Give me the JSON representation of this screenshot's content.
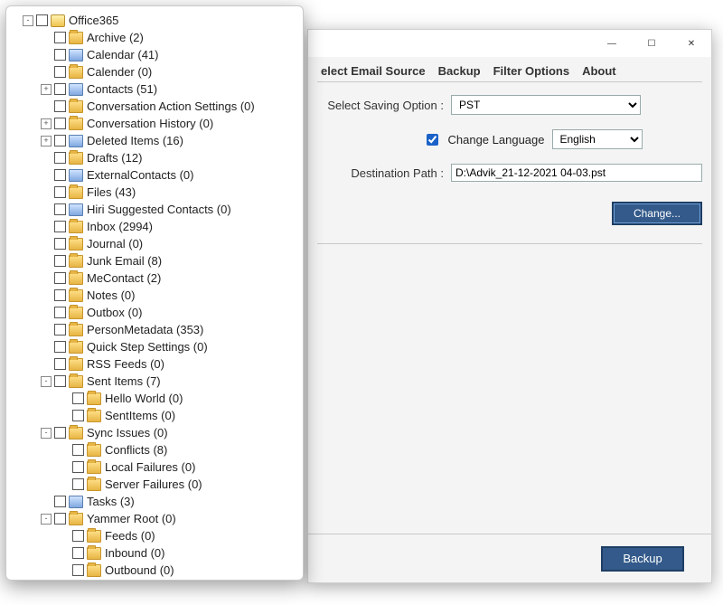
{
  "tree": {
    "root": "Office365",
    "items": [
      {
        "label": "Archive (2)",
        "exp": "",
        "d": 2,
        "icon": "folder"
      },
      {
        "label": "Calendar (41)",
        "exp": "",
        "d": 2,
        "icon": "special"
      },
      {
        "label": "Calender (0)",
        "exp": "",
        "d": 2,
        "icon": "folder"
      },
      {
        "label": "Contacts (51)",
        "exp": "+",
        "d": 2,
        "icon": "special"
      },
      {
        "label": "Conversation Action Settings (0)",
        "exp": "",
        "d": 2,
        "icon": "folder"
      },
      {
        "label": "Conversation History (0)",
        "exp": "+",
        "d": 2,
        "icon": "folder"
      },
      {
        "label": "Deleted Items (16)",
        "exp": "+",
        "d": 2,
        "icon": "special"
      },
      {
        "label": "Drafts (12)",
        "exp": "",
        "d": 2,
        "icon": "folder"
      },
      {
        "label": "ExternalContacts (0)",
        "exp": "",
        "d": 2,
        "icon": "special"
      },
      {
        "label": "Files (43)",
        "exp": "",
        "d": 2,
        "icon": "folder"
      },
      {
        "label": "Hiri Suggested Contacts (0)",
        "exp": "",
        "d": 2,
        "icon": "special"
      },
      {
        "label": "Inbox (2994)",
        "exp": "",
        "d": 2,
        "icon": "folder"
      },
      {
        "label": "Journal (0)",
        "exp": "",
        "d": 2,
        "icon": "folder"
      },
      {
        "label": "Junk Email (8)",
        "exp": "",
        "d": 2,
        "icon": "folder"
      },
      {
        "label": "MeContact (2)",
        "exp": "",
        "d": 2,
        "icon": "folder"
      },
      {
        "label": "Notes (0)",
        "exp": "",
        "d": 2,
        "icon": "folder"
      },
      {
        "label": "Outbox (0)",
        "exp": "",
        "d": 2,
        "icon": "folder"
      },
      {
        "label": "PersonMetadata (353)",
        "exp": "",
        "d": 2,
        "icon": "folder"
      },
      {
        "label": "Quick Step Settings (0)",
        "exp": "",
        "d": 2,
        "icon": "folder"
      },
      {
        "label": "RSS Feeds (0)",
        "exp": "",
        "d": 2,
        "icon": "folder"
      },
      {
        "label": "Sent Items (7)",
        "exp": "-",
        "d": 2,
        "icon": "folder"
      },
      {
        "label": "Hello World (0)",
        "exp": "",
        "d": 3,
        "icon": "folder"
      },
      {
        "label": "SentItems (0)",
        "exp": "",
        "d": 3,
        "icon": "folder"
      },
      {
        "label": "Sync Issues (0)",
        "exp": "-",
        "d": 2,
        "icon": "folder"
      },
      {
        "label": "Conflicts (8)",
        "exp": "",
        "d": 3,
        "icon": "folder"
      },
      {
        "label": "Local Failures (0)",
        "exp": "",
        "d": 3,
        "icon": "folder"
      },
      {
        "label": "Server Failures (0)",
        "exp": "",
        "d": 3,
        "icon": "folder"
      },
      {
        "label": "Tasks (3)",
        "exp": "",
        "d": 2,
        "icon": "special"
      },
      {
        "label": "Yammer Root (0)",
        "exp": "-",
        "d": 2,
        "icon": "folder"
      },
      {
        "label": "Feeds (0)",
        "exp": "",
        "d": 3,
        "icon": "folder"
      },
      {
        "label": "Inbound (0)",
        "exp": "",
        "d": 3,
        "icon": "folder"
      },
      {
        "label": "Outbound (0)",
        "exp": "",
        "d": 3,
        "icon": "folder"
      }
    ]
  },
  "tabs": {
    "t0": "elect Email Source",
    "t1": "Backup",
    "t2": "Filter Options",
    "t3": "About"
  },
  "form": {
    "saving_label": "Select Saving Option  :",
    "saving_value": "PST",
    "change_lang_label": "Change Language",
    "lang_value": "English",
    "dest_label": "Destination Path  :",
    "dest_value": "D:\\Advik_21-12-2021 04-03.pst",
    "change_btn": "Change...",
    "backup_btn": "Backup"
  },
  "winbtns": {
    "min": "—",
    "max": "☐",
    "close": "✕"
  }
}
